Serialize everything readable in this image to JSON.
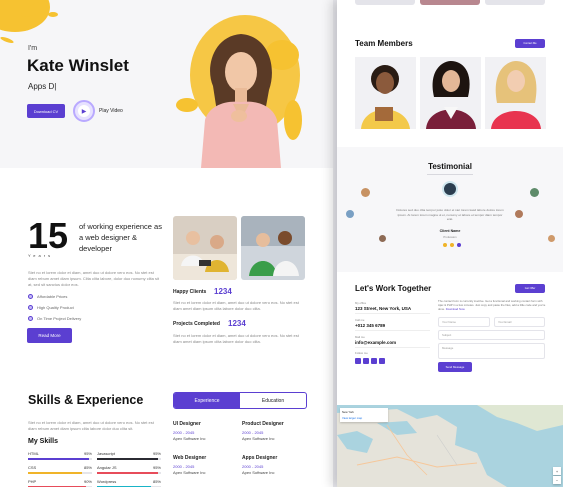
{
  "hero": {
    "greeting": "I'm",
    "name": "Kate Winslet",
    "role": "Apps D|",
    "download_label": "Download CV",
    "play_label": "Play Video"
  },
  "about": {
    "years_number": "15",
    "years_label": "Years",
    "headline": "of working experience as a web designer & developer",
    "paragraph": "Stet no et lorem dolor et diam, amet duo ut dolore vero eos. No stet est diam rebum amet diam ipsum. Clita clita labore, dolor duo nonumy clita sit at, sed sit sanctus dolor eos.",
    "features": [
      "Affordable Prices",
      "High Quality Product",
      "On Time Project Delivery"
    ],
    "read_more_label": "Read More",
    "stats": [
      {
        "label": "Happy Clients",
        "value": "1234",
        "text": "Stet no et lorem dolor et diam, amet duo ut dolore vero eos. No stet est diam amet diam ipsum clita labore dolor duo clita."
      },
      {
        "label": "Projects Completed",
        "value": "1234",
        "text": "Stet no et lorem dolor et diam, amet duo ut dolore vero eos. No stet est diam amet diam ipsum clita labore dolor duo clita."
      }
    ]
  },
  "skills": {
    "title": "Skills & Experience",
    "paragraph": "Stet no et lorem dolor et diam, amet duo ut dolore vero eos. No stet est diam rebum amet diam ipsum clita labore dolor duo clita sit.",
    "subtitle": "My Skills",
    "bars": [
      {
        "name": "HTML",
        "percent": "95%",
        "value": 95,
        "color": "#5b3fd1"
      },
      {
        "name": "Javascript",
        "percent": "95%",
        "value": 95,
        "color": "#2b2b33"
      },
      {
        "name": "CSS",
        "percent": "85%",
        "value": 85,
        "color": "#f0b429"
      },
      {
        "name": "Angular JS",
        "percent": "95%",
        "value": 95,
        "color": "#e74c5a"
      },
      {
        "name": "PHP",
        "percent": "90%",
        "value": 90,
        "color": "#e74c5a"
      },
      {
        "name": "Wordpress",
        "percent": "85%",
        "value": 85,
        "color": "#19b4c7"
      }
    ],
    "tabs": [
      {
        "label": "Experience"
      },
      {
        "label": "Education"
      }
    ],
    "jobs": [
      {
        "title": "UI Designer",
        "dates": "2000 - 2045",
        "company": "Apex Software Inc"
      },
      {
        "title": "Product Designer",
        "dates": "2000 - 2045",
        "company": "Apex Software Inc"
      },
      {
        "title": "Web Designer",
        "dates": "2000 - 2045",
        "company": "Apex Software Inc"
      },
      {
        "title": "Apps Designer",
        "dates": "2000 - 2045",
        "company": "Apex Software Inc"
      }
    ]
  },
  "team": {
    "title": "Team Members",
    "button_label": "Contact Me"
  },
  "testimonial": {
    "title": "Testimonial",
    "quote": "Dolores sed duo clita tempor justo dolor et stet lorem kasd labore dolore lorem ipsum. At lorem lorem magna ut et, nonumy et labore et tempor diam tempor erat.",
    "client_name": "Client Name",
    "client_role": "Profession"
  },
  "contact": {
    "title": "Let's Work Together",
    "button_label": "Get Offer",
    "office_label": "My office",
    "office_value": "123 Street, New York, USA",
    "call_label": "Call me",
    "call_value": "+012 345 6789",
    "mail_label": "Mail me",
    "mail_value": "info@example.com",
    "follow_label": "Follow me",
    "description": "The contact form is currently inactive. Get a functional and working contact form with Ajax & PHP in a few minutes. Just copy and paste the files, add a little code and you're done.",
    "description_link": "Download Now.",
    "fields": {
      "name": "Your Name",
      "email": "Your Email",
      "subject": "Subject",
      "message": "Message"
    },
    "send_label": "Send Message"
  },
  "map": {
    "place": "New York",
    "link": "View larger map",
    "zoom_in": "+",
    "zoom_out": "−"
  },
  "colors": {
    "accent": "#5b3fd1",
    "yellow": "#f6c231"
  }
}
